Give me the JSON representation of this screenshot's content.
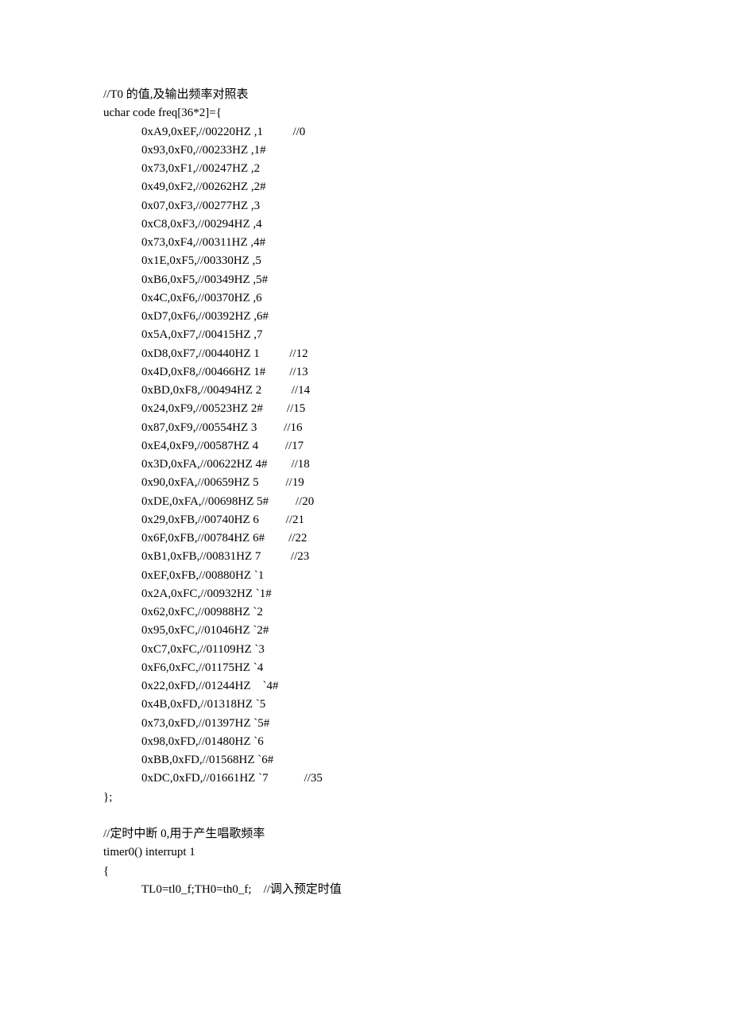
{
  "lines": [
    {
      "text": "//T0 的值,及输出频率对照表",
      "indent": false
    },
    {
      "text": "uchar code freq[36*2]={",
      "indent": false
    },
    {
      "text": "0xA9,0xEF,//00220HZ ,1          //0",
      "indent": true
    },
    {
      "text": "0x93,0xF0,//00233HZ ,1#",
      "indent": true
    },
    {
      "text": "0x73,0xF1,//00247HZ ,2",
      "indent": true
    },
    {
      "text": "0x49,0xF2,//00262HZ ,2#",
      "indent": true
    },
    {
      "text": "0x07,0xF3,//00277HZ ,3",
      "indent": true
    },
    {
      "text": "0xC8,0xF3,//00294HZ ,4",
      "indent": true
    },
    {
      "text": "0x73,0xF4,//00311HZ ,4#",
      "indent": true
    },
    {
      "text": "0x1E,0xF5,//00330HZ ,5",
      "indent": true
    },
    {
      "text": "0xB6,0xF5,//00349HZ ,5#",
      "indent": true
    },
    {
      "text": "0x4C,0xF6,//00370HZ ,6",
      "indent": true
    },
    {
      "text": "0xD7,0xF6,//00392HZ ,6#",
      "indent": true
    },
    {
      "text": "0x5A,0xF7,//00415HZ ,7",
      "indent": true
    },
    {
      "text": "0xD8,0xF7,//00440HZ 1          //12",
      "indent": true
    },
    {
      "text": "0x4D,0xF8,//00466HZ 1#        //13",
      "indent": true
    },
    {
      "text": "0xBD,0xF8,//00494HZ 2          //14",
      "indent": true
    },
    {
      "text": "0x24,0xF9,//00523HZ 2#        //15",
      "indent": true
    },
    {
      "text": "0x87,0xF9,//00554HZ 3         //16",
      "indent": true
    },
    {
      "text": "0xE4,0xF9,//00587HZ 4         //17",
      "indent": true
    },
    {
      "text": "0x3D,0xFA,//00622HZ 4#        //18",
      "indent": true
    },
    {
      "text": "0x90,0xFA,//00659HZ 5         //19",
      "indent": true
    },
    {
      "text": "0xDE,0xFA,//00698HZ 5#         //20",
      "indent": true
    },
    {
      "text": "0x29,0xFB,//00740HZ 6         //21",
      "indent": true
    },
    {
      "text": "0x6F,0xFB,//00784HZ 6#        //22",
      "indent": true
    },
    {
      "text": "0xB1,0xFB,//00831HZ 7          //23",
      "indent": true
    },
    {
      "text": "0xEF,0xFB,//00880HZ `1",
      "indent": true
    },
    {
      "text": "0x2A,0xFC,//00932HZ `1#",
      "indent": true
    },
    {
      "text": "0x62,0xFC,//00988HZ `2",
      "indent": true
    },
    {
      "text": "0x95,0xFC,//01046HZ `2#",
      "indent": true
    },
    {
      "text": "0xC7,0xFC,//01109HZ `3",
      "indent": true
    },
    {
      "text": "0xF6,0xFC,//01175HZ `4",
      "indent": true
    },
    {
      "text": "0x22,0xFD,//01244HZ    `4#",
      "indent": true
    },
    {
      "text": "0x4B,0xFD,//01318HZ `5",
      "indent": true
    },
    {
      "text": "0x73,0xFD,//01397HZ `5#",
      "indent": true
    },
    {
      "text": "0x98,0xFD,//01480HZ `6",
      "indent": true
    },
    {
      "text": "0xBB,0xFD,//01568HZ `6#",
      "indent": true
    },
    {
      "text": "0xDC,0xFD,//01661HZ `7            //35",
      "indent": true
    },
    {
      "text": "};",
      "indent": false
    },
    {
      "text": "",
      "indent": false,
      "blank": true
    },
    {
      "text": "//定时中断 0,用于产生唱歌频率",
      "indent": false
    },
    {
      "text": "timer0() interrupt 1",
      "indent": false
    },
    {
      "text": "{",
      "indent": false
    },
    {
      "text": "TL0=tl0_f;TH0=th0_f;    //调入预定时值",
      "indent": true
    }
  ]
}
